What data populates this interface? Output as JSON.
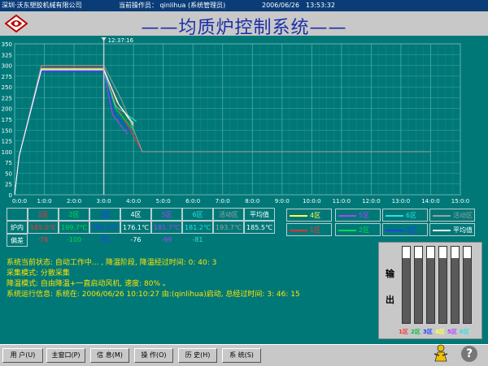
{
  "topbar": {
    "company": "深圳·沃东塑胶机械有限公司",
    "operator": "当前操作员： qinlihua (系统管理员)",
    "date": "2006/06/26",
    "time": "13:53:32"
  },
  "header": {
    "title": "——均质炉控制系统——"
  },
  "chart_data": {
    "type": "line",
    "title": "",
    "xlabel": "",
    "ylabel": "",
    "cursor_time": "12:37:16",
    "cursor_x": "3:00:0",
    "ylim": [
      0,
      350
    ],
    "yticks": [
      "350",
      "325",
      "300",
      "275",
      "250",
      "225",
      "200",
      "175",
      "150",
      "125",
      "100",
      "75",
      "50",
      "25",
      "0"
    ],
    "xlim": [
      0,
      15
    ],
    "xticks": [
      "0:0:0",
      "1:0:0",
      "2:0:0",
      "3:0:0",
      "4:0:0",
      "5:0:0",
      "6:0:0",
      "7:0:0",
      "8:0:0",
      "9:0:0",
      "10:0:0",
      "11:0:0",
      "12:0:0",
      "13:0:0",
      "14:0:0",
      "15:0:0"
    ],
    "grid": true,
    "series": [
      {
        "name": "1区",
        "color": "#ff3030",
        "x": [
          0,
          0.15,
          0.9,
          3.0,
          3.4,
          4.3
        ],
        "y": [
          0,
          90,
          295,
          295,
          210,
          100
        ]
      },
      {
        "name": "2区",
        "color": "#00e040",
        "x": [
          0,
          0.15,
          0.9,
          3.0,
          3.4,
          4.0
        ],
        "y": [
          0,
          90,
          290,
          290,
          200,
          150
        ]
      },
      {
        "name": "3区",
        "color": "#2040ff",
        "x": [
          0,
          0.15,
          0.9,
          3.0,
          3.35,
          3.9
        ],
        "y": [
          0,
          90,
          285,
          285,
          190,
          145
        ]
      },
      {
        "name": "4区",
        "color": "#ffff40",
        "x": [
          0,
          0.15,
          0.9,
          3.0,
          3.45,
          4.0
        ],
        "y": [
          0,
          90,
          292,
          292,
          215,
          160
        ]
      },
      {
        "name": "5区",
        "color": "#b040ff",
        "x": [
          0,
          0.15,
          0.9,
          3.0,
          3.3,
          3.8
        ],
        "y": [
          0,
          90,
          288,
          288,
          185,
          140
        ]
      },
      {
        "name": "6区",
        "color": "#30e0e0",
        "x": [
          0,
          0.15,
          0.9,
          3.0,
          3.4,
          4.1
        ],
        "y": [
          0,
          90,
          290,
          290,
          205,
          170
        ]
      },
      {
        "name": "活动区",
        "color": "#a0a0a0",
        "x": [
          0,
          0.15,
          0.9,
          3.0,
          3.6,
          4.3,
          14.0
        ],
        "y": [
          0,
          90,
          300,
          300,
          220,
          100,
          100
        ]
      },
      {
        "name": "平均值",
        "color": "#ffffff",
        "x": [
          0,
          0.15,
          0.9,
          3.0,
          3.5,
          4.0
        ],
        "y": [
          0,
          90,
          290,
          290,
          210,
          165
        ]
      }
    ]
  },
  "table": {
    "headers": [
      "1区",
      "2区",
      "3区",
      "4区",
      "5区",
      "6区",
      "活动区",
      "平均值"
    ],
    "header_colors": [
      "#ff3030",
      "#00e040",
      "#2040ff",
      "#ffffff",
      "#b040ff",
      "#30e0e0",
      "#a0a0a0",
      "#ffffff"
    ],
    "row_label_in": "炉内",
    "row_label_dev": "偏差",
    "values": [
      "185.0℃",
      "199.7℃",
      "181.3℃",
      "176.1℃",
      "181.7℃",
      "181.2℃",
      "193.7℃",
      "185.5℃"
    ],
    "value_colors": [
      "#ff3030",
      "#00e040",
      "#2040ff",
      "#ffffff",
      "#b040ff",
      "#30e0e0",
      "#a0a0a0",
      "#ffffff"
    ],
    "deviations": [
      "-76",
      "-100",
      "-81",
      "-76",
      "-99",
      "-81"
    ],
    "dev_colors": [
      "#ff3030",
      "#00e040",
      "#2040ff",
      "#ffffff",
      "#b040ff",
      "#30e0e0"
    ]
  },
  "legend": [
    {
      "label": "4区",
      "color": "#ffff40"
    },
    {
      "label": "5区",
      "color": "#b040ff"
    },
    {
      "label": "6区",
      "color": "#30e0e0"
    },
    {
      "label": "活动区",
      "color": "#a0a0a0"
    },
    {
      "label": "1区",
      "color": "#ff3030"
    },
    {
      "label": "2区",
      "color": "#00e040"
    },
    {
      "label": "3区",
      "color": "#2040ff"
    },
    {
      "label": "平均值",
      "color": "#ffffff"
    }
  ],
  "status": {
    "line1": "系统当前状态: 自动工作中...     ,  降温阶段, 降温经过时间: 0: 40: 3",
    "line2": "   采集模式: 分散采集",
    "line3": "   降温模式: 自由降温+一直启动风机, 速度: 80% 。",
    "line4": "系统运行信息: 系统在: 2006/06/26 10:10:27 由:(qinlihua)启动, 总经过时间: 3: 46: 15"
  },
  "output_panel": {
    "label_top": "输",
    "label_bottom": "出",
    "levels": [
      0.85,
      0.85,
      0.85,
      0.85,
      0.85,
      0.85
    ],
    "zones": [
      {
        "label": "1区",
        "color": "#ff3030"
      },
      {
        "label": "2区",
        "color": "#00c040"
      },
      {
        "label": "3区",
        "color": "#2040ff"
      },
      {
        "label": "4区",
        "color": "#ffff40"
      },
      {
        "label": "5区",
        "color": "#b040ff"
      },
      {
        "label": "6区",
        "color": "#30e0e0"
      }
    ]
  },
  "bottombar": {
    "buttons": [
      "用 户(U)",
      "主窗口(P)",
      "信 息(M)",
      "操 作(O)",
      "历 史(H)",
      "系 统(S)"
    ],
    "help": "?"
  }
}
